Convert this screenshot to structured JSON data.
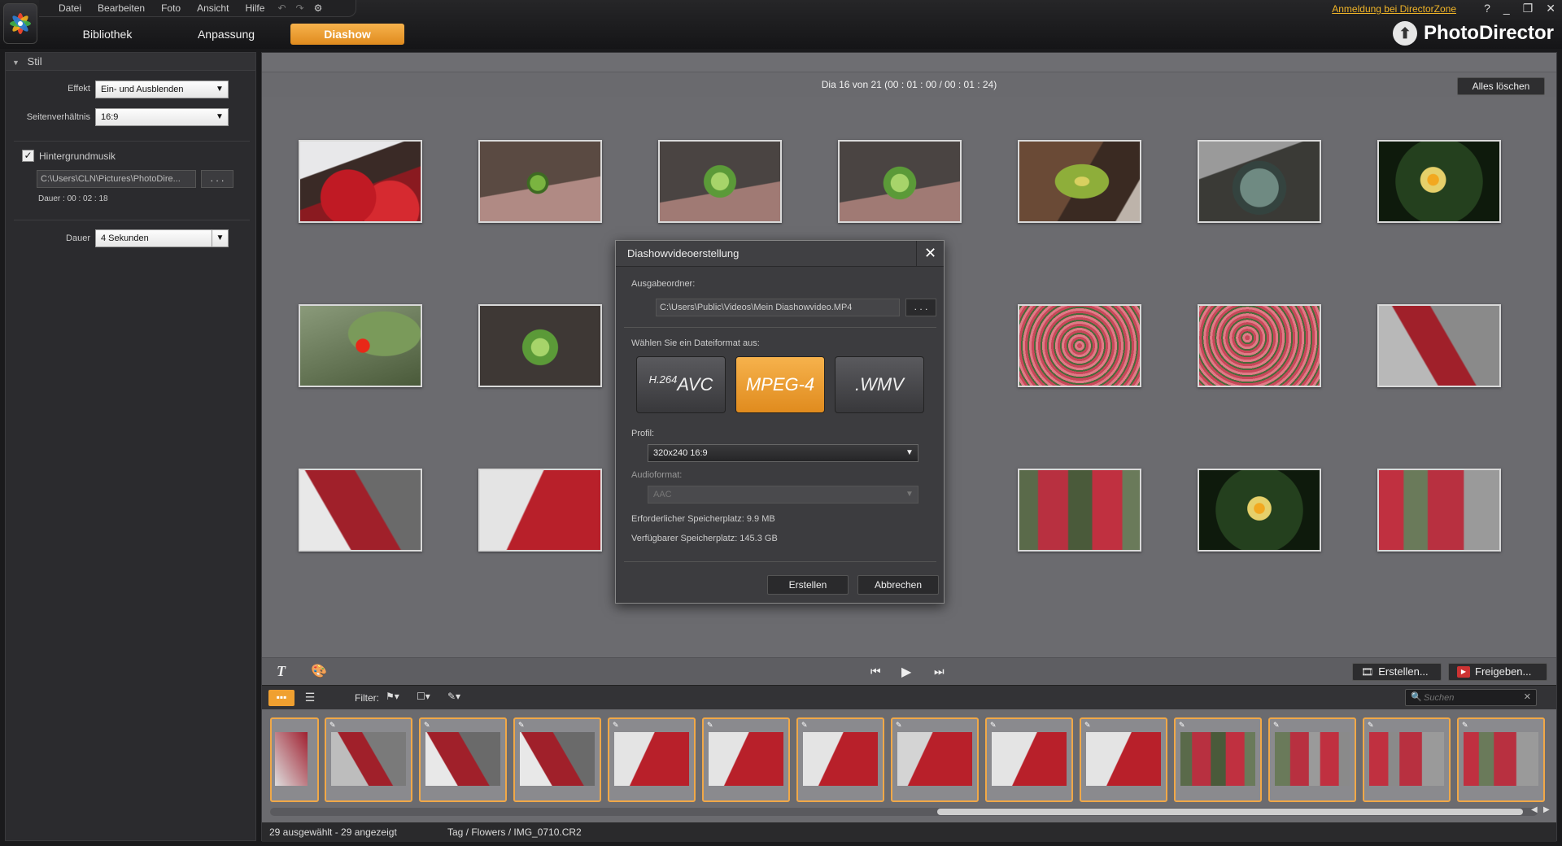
{
  "menu": {
    "items": [
      "Datei",
      "Bearbeiten",
      "Foto",
      "Ansicht",
      "Hilfe"
    ]
  },
  "modes": {
    "library": "Bibliothek",
    "adjust": "Anpassung",
    "slideshow": "Diashow"
  },
  "header": {
    "login": "Anmeldung bei DirectorZone",
    "brand": "PhotoDirector",
    "help": "?",
    "minimize": "_",
    "restore": "❐",
    "close": "✕"
  },
  "left_panel": {
    "section": "Stil",
    "effect_label": "Effekt",
    "effect_value": "Ein- und Ausblenden",
    "aspect_label": "Seitenverhältnis",
    "aspect_value": "16:9",
    "music_label": "Hintergrundmusik",
    "music_checked": true,
    "music_path": "C:\\Users\\CLN\\Pictures\\PhotoDire...",
    "browse": ". . .",
    "music_duration": "Dauer : 00 : 02 : 18",
    "duration_label": "Dauer",
    "duration_value": "4 Sekunden"
  },
  "main": {
    "slide_info": "Dia  16 von  21 (00 : 01 : 00 / 00 : 01 : 24)",
    "clear_all": "Alles löschen"
  },
  "toolbar": {
    "create": "Erstellen...",
    "share": "Freigeben...",
    "filter_label": "Filter:",
    "search_placeholder": "Suchen"
  },
  "status": {
    "selected": "29 ausgewählt - 29 angezeigt",
    "path": "Tag / Flowers / IMG_0710.CR2"
  },
  "dialog": {
    "title": "Diashowvideoerstellung",
    "output_label": "Ausgabeordner:",
    "output_path": "C:\\Users\\Public\\Videos\\Mein Diashowvideo.MP4",
    "browse": ". . .",
    "format_label": "Wählen Sie ein Dateiformat aus:",
    "formats": [
      {
        "small": "H.264",
        "big": "AVC",
        "selected": false
      },
      {
        "small": "",
        "big": "MPEG-4",
        "selected": true
      },
      {
        "small": "",
        "big": ".WMV",
        "selected": false
      }
    ],
    "profile_label": "Profil:",
    "profile_value": "320x240 16:9",
    "audio_label": "Audioformat:",
    "audio_value": "AAC",
    "required_space": "Erforderlicher Speicherplatz: 9.9 MB",
    "available_space": "Verfügbarer Speicherplatz: 145.3 GB",
    "create": "Erstellen",
    "cancel": "Abbrechen"
  },
  "colors": {
    "accent": "#f0a030",
    "link": "#f0b428",
    "background_main": "#6b6b6f",
    "panel": "#2b2b2e"
  }
}
